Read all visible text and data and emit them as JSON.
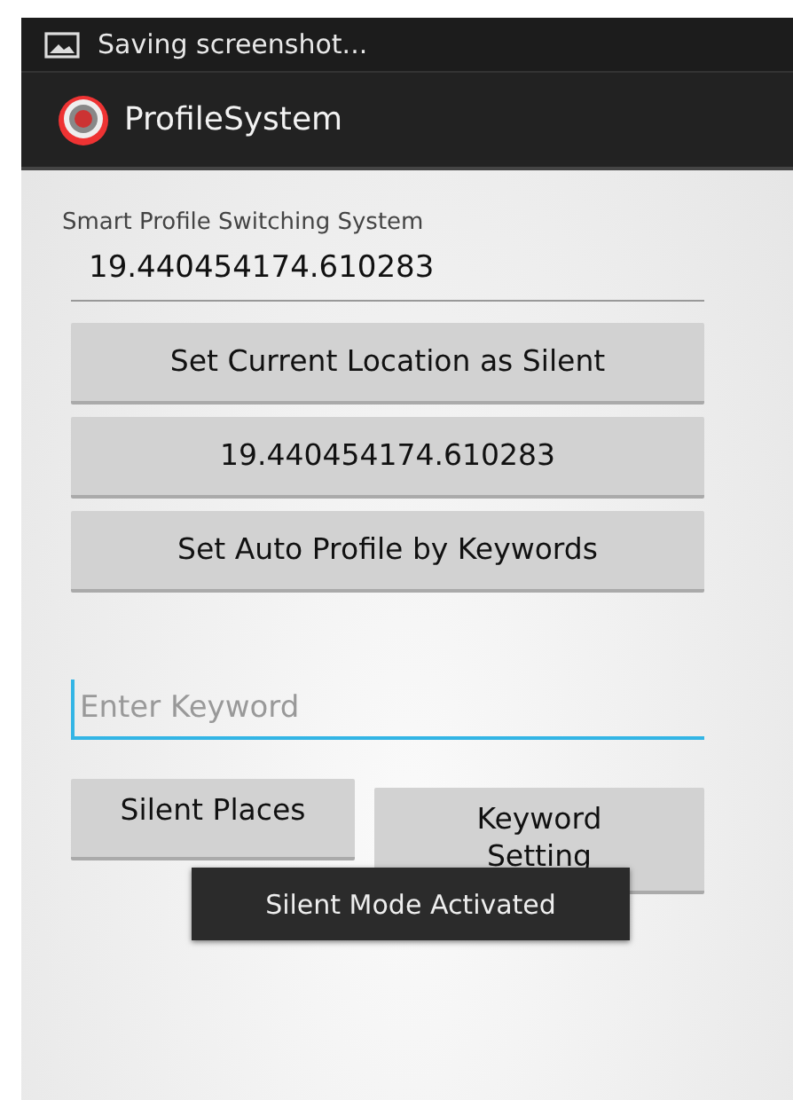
{
  "status_bar": {
    "notification": "Saving screenshot..."
  },
  "action_bar": {
    "title": "ProfileSystem"
  },
  "subtitle": "Smart Profile Switching System",
  "location_field": {
    "value": "19.440454174.610283"
  },
  "buttons": [
    "Set Current Location as Silent",
    "19.440454174.610283",
    "Set Auto Profile by Keywords"
  ],
  "keyword_field": {
    "placeholder": "Enter Keyword",
    "focused": true
  },
  "bottom_buttons": [
    "Silent Places",
    "Keyword Setting"
  ],
  "toast": "Silent Mode Activated"
}
